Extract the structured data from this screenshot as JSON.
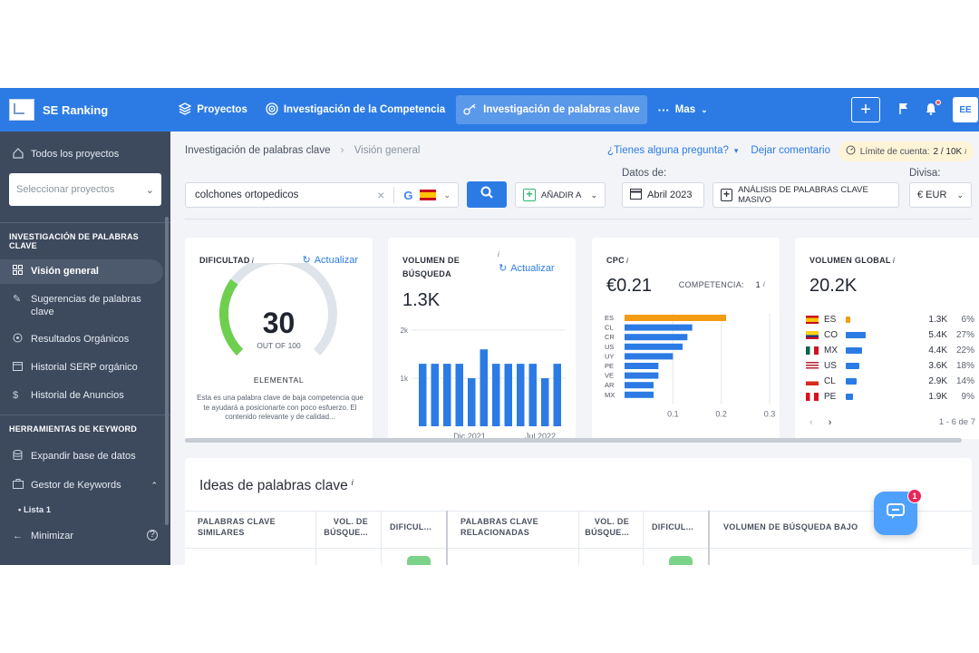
{
  "brand": "SE Ranking",
  "nav": [
    {
      "label": "Proyectos",
      "icon": "layers-icon"
    },
    {
      "label": "Investigación de la Competencia",
      "icon": "target-icon"
    },
    {
      "label": "Investigación de palabras clave",
      "icon": "key-icon",
      "active": true
    },
    {
      "label": "Mas",
      "icon": "dots-icon"
    }
  ],
  "avatar": "EE",
  "sidebar": {
    "all_projects": "Todos los proyectos",
    "select_placeholder": "Seleccionar proyectos",
    "section1": "INVESTIGACIÓN DE PALABRAS CLAVE",
    "items1": [
      "Visión general",
      "Sugerencias de palabras clave",
      "Resultados Orgánicos",
      "Historial SERP orgánico",
      "Historial de Anuncios"
    ],
    "section2": "HERRAMIENTAS DE KEYWORD",
    "items2": [
      "Expandir base de datos",
      "Gestor de Keywords"
    ],
    "sub_item": "Lista 1",
    "minimize": "Minimizar"
  },
  "breadcrumb": {
    "first": "Investigación de palabras clave",
    "second": "Visión general"
  },
  "help": {
    "question": "¿Tienes alguna pregunta?",
    "feedback": "Dejar comentario"
  },
  "limit": {
    "label": "Límite de cuenta:",
    "value": "2 / 10K",
    "info": "i"
  },
  "search": {
    "query": "colchones ortopedicos",
    "engine": "G",
    "database": "es"
  },
  "buttons": {
    "add_to": "AÑADIR A",
    "bulk": "ANÁLISIS DE PALABRAS CLAVE MASIVO"
  },
  "date": {
    "label": "Datos de:",
    "value": "Abril 2023"
  },
  "currency": {
    "label": "Divisa:",
    "value": "€ EUR"
  },
  "cards": {
    "difficulty": {
      "title": "DIFICULTAD",
      "refresh": "Actualizar",
      "value": "30",
      "out_of": "OUT OF 100",
      "level": "ELEMENTAL",
      "score": 30,
      "desc": "Esta es una palabra clave de baja competencia que te ayudará a posicionarte con poco esfuerzo. El contenido relevante y de calidad..."
    },
    "volume": {
      "title_line1": "VOLUMEN DE",
      "title_line2": "BÚSQUEDA",
      "refresh": "Actualizar",
      "value": "1.3K"
    },
    "cpc": {
      "title": "CPC",
      "value": "€0.21",
      "competition_label": "COMPETENCIA:",
      "competition_value": "1"
    },
    "global": {
      "title": "VOLUMEN GLOBAL",
      "value": "20.2K",
      "pager": "1 - 6 de 7"
    }
  },
  "chart_data": [
    {
      "type": "bar",
      "title": "VOLUMEN DE BÚSQUEDA",
      "categories": [
        "",
        "",
        "",
        "",
        "",
        "",
        "",
        "",
        "",
        "",
        "",
        ""
      ],
      "x_tick_labels": [
        "Dic 2021",
        "Jul 2022"
      ],
      "y_tick_labels": [
        "1k",
        "2k"
      ],
      "values": [
        1300,
        1300,
        1300,
        1300,
        1000,
        1600,
        1300,
        1300,
        1300,
        1300,
        1000,
        1300
      ],
      "ylim": [
        0,
        2000
      ],
      "color": "#2c7be5"
    },
    {
      "type": "bar",
      "orientation": "horizontal",
      "title": "CPC",
      "categories": [
        "ES",
        "CL",
        "CR",
        "US",
        "UY",
        "PE",
        "VE",
        "AR",
        "MX"
      ],
      "values": [
        0.21,
        0.14,
        0.13,
        0.12,
        0.1,
        0.07,
        0.07,
        0.06,
        0.06
      ],
      "x_tick_labels": [
        "0.1",
        "0.2",
        "0.3"
      ],
      "xlim": [
        0,
        0.3
      ],
      "highlight_color": "#f39c12",
      "color": "#2c7be5"
    },
    {
      "type": "bar",
      "orientation": "horizontal",
      "title": "VOLUMEN GLOBAL",
      "categories": [
        "ES",
        "CO",
        "MX",
        "US",
        "CL",
        "PE"
      ],
      "values": [
        1300,
        5400,
        4400,
        3600,
        2900,
        1900
      ],
      "value_labels": [
        "1.3K",
        "5.4K",
        "4.4K",
        "3.6K",
        "2.9K",
        "1.9K"
      ],
      "percent_labels": [
        "6%",
        "27%",
        "22%",
        "18%",
        "14%",
        "9%"
      ]
    }
  ],
  "ideas": {
    "title": "Ideas de palabras clave",
    "headers": [
      "PALABRAS CLAVE SIMILARES",
      "VOL. DE BÚSQUE...",
      "DIFICUL...",
      "PALABRAS CLAVE RELACIONADAS",
      "VOL. DE BÚSQUE...",
      "DIFICUL...",
      "VOLUMEN DE BÚSQUEDA BAJO"
    ]
  },
  "chat": {
    "badge": "1"
  }
}
